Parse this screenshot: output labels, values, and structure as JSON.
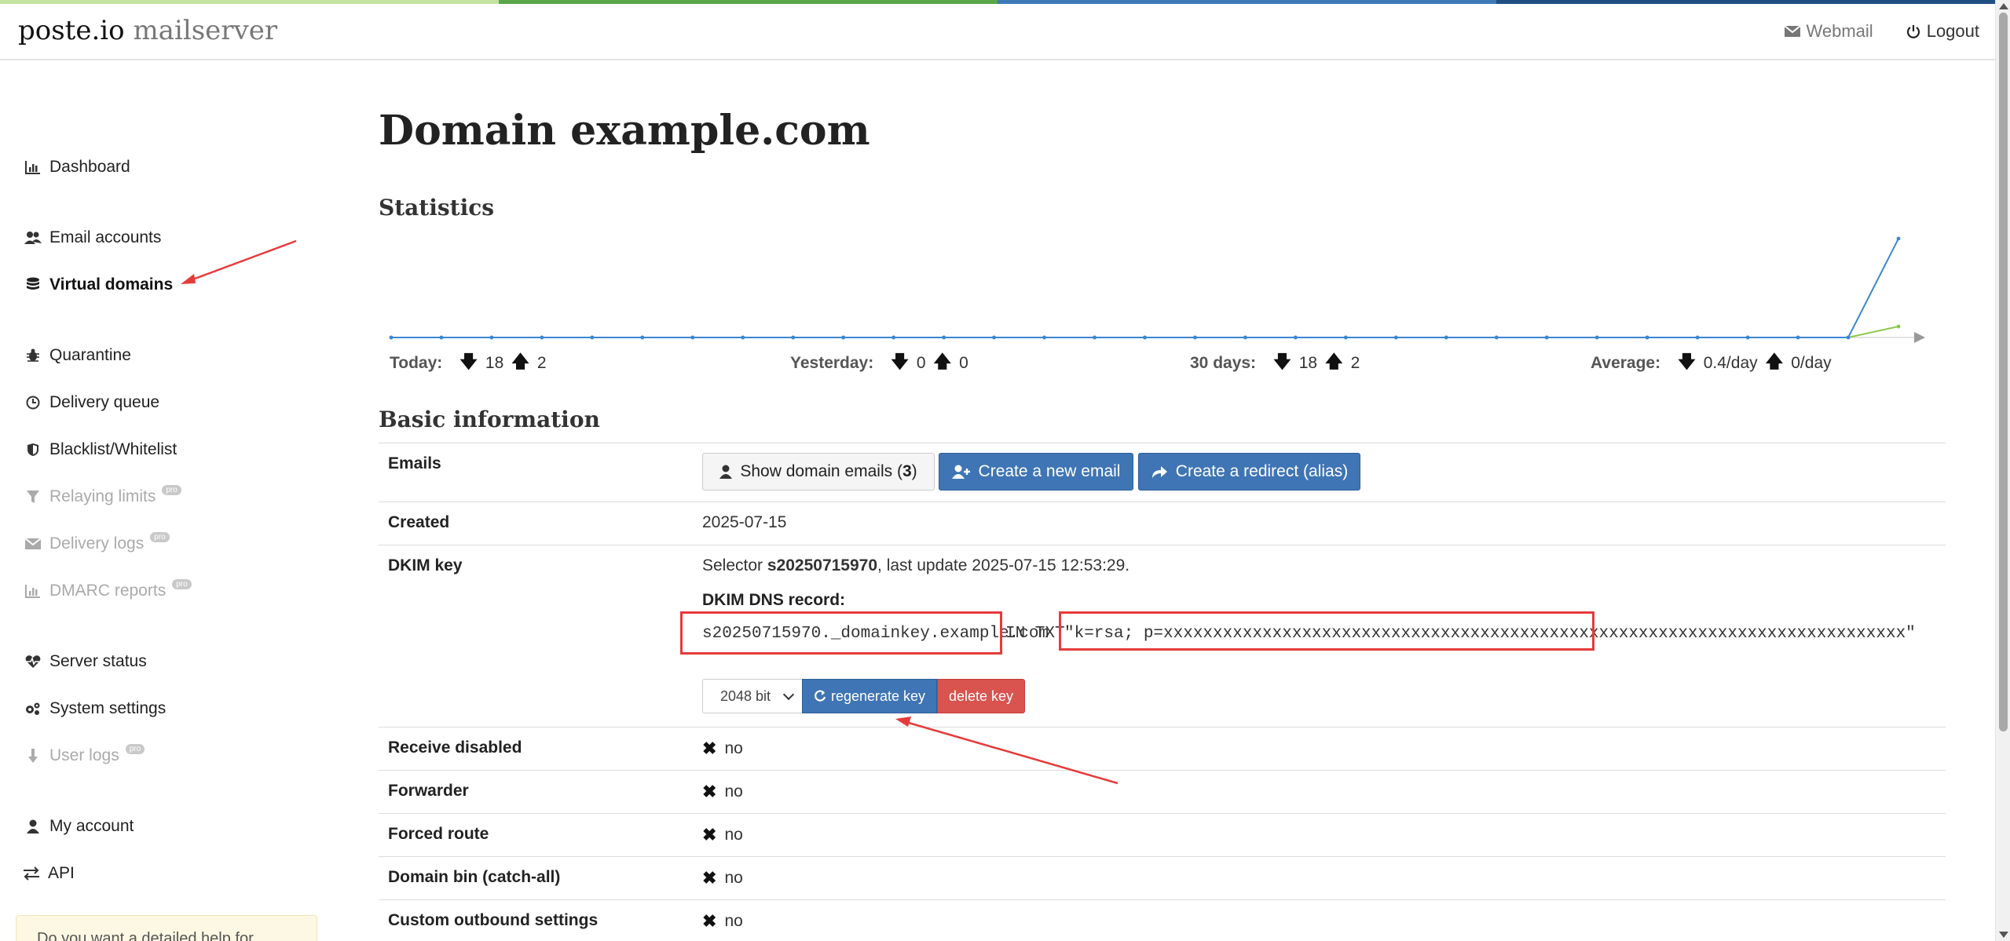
{
  "colors": {
    "topbar": [
      "#c5e3a3",
      "#5aa64a",
      "#3e79b8",
      "#1f4f82"
    ],
    "primary": "#3f75b5",
    "danger": "#d9534f",
    "annotation": "#e53b3b",
    "chart_series_in": "#3a87d4",
    "chart_series_out": "#8cc84b"
  },
  "header": {
    "brand": "poste.io",
    "brand_suffix": "mailserver",
    "webmail": "Webmail",
    "logout": "Logout",
    "webmail_icon": "envelope-icon",
    "logout_icon": "power-icon"
  },
  "sidebar": {
    "items": [
      {
        "label": "Dashboard",
        "icon": "bar-chart-icon"
      },
      {
        "label": "Email accounts",
        "icon": "users-icon"
      },
      {
        "label": "Virtual domains",
        "icon": "database-icon"
      },
      {
        "label": "Quarantine",
        "icon": "bug-icon"
      },
      {
        "label": "Delivery queue",
        "icon": "clock-icon"
      },
      {
        "label": "Blacklist/Whitelist",
        "icon": "shield-icon"
      },
      {
        "label": "Relaying limits",
        "icon": "filter-icon",
        "badge": "pro"
      },
      {
        "label": "Delivery logs",
        "icon": "envelope-icon",
        "badge": "pro"
      },
      {
        "label": "DMARC reports",
        "icon": "bar-chart-icon",
        "badge": "pro"
      },
      {
        "label": "Server status",
        "icon": "heartbeat-icon"
      },
      {
        "label": "System settings",
        "icon": "cogs-icon"
      },
      {
        "label": "User logs",
        "icon": "user-log-icon",
        "badge": "pro"
      },
      {
        "label": "My account",
        "icon": "user-icon"
      },
      {
        "label": "API",
        "icon": "exchange-icon"
      }
    ],
    "help_box": "Do you want a detailed help for"
  },
  "main": {
    "title": "Domain example.com",
    "statistics_title": "Statistics",
    "stats": [
      {
        "label": "Today:",
        "down": "18",
        "up": "2"
      },
      {
        "label": "Yesterday:",
        "down": "0",
        "up": "0"
      },
      {
        "label": "30 days:",
        "down": "18",
        "up": "2"
      },
      {
        "label": "Average:",
        "down": "0.4/day",
        "up": "0/day"
      }
    ],
    "basic_title": "Basic information",
    "rows": {
      "emails": {
        "key": "Emails",
        "show_btn": "Show domain emails (",
        "show_count": "3",
        "show_btn_end": ")",
        "create_email": "Create a new email",
        "create_redirect": "Create a redirect (alias)"
      },
      "created": {
        "key": "Created",
        "value": "2025-07-15"
      },
      "dkim": {
        "key": "DKIM key",
        "selector_prefix": "Selector ",
        "selector": "s20250715970",
        "selector_suffix": ", last update 2025-07-15 12:53:29.",
        "record_label": "DKIM DNS record:",
        "record_name": "s20250715970._domainkey.example.com",
        "record_type": "IN TXT",
        "record_value": "\"k=rsa; p=xxxxxxxxxxxxxxxxxxxxxxxxxxxxxxxxxxxxxxxxxxxxxxxxxxxxxxxxxxxxxxxxxxxxxxxxxxx\"",
        "bits": "2048 bit",
        "regenerate": "regenerate key",
        "delete": "delete key"
      },
      "receive_disabled": {
        "key": "Receive disabled",
        "value": "no"
      },
      "forwarder": {
        "key": "Forwarder",
        "value": "no"
      },
      "forced_route": {
        "key": "Forced route",
        "value": "no"
      },
      "domain_bin": {
        "key": "Domain bin (catch-all)",
        "value": "no"
      },
      "custom_outbound": {
        "key": "Custom outbound settings",
        "value": "no"
      }
    }
  },
  "chart_data": {
    "type": "line",
    "title": "",
    "xlabel": "",
    "ylabel": "",
    "x_count": 31,
    "series": [
      {
        "values": [
          0,
          0,
          0,
          0,
          0,
          0,
          0,
          0,
          0,
          0,
          0,
          0,
          0,
          0,
          0,
          0,
          0,
          0,
          0,
          0,
          0,
          0,
          0,
          0,
          0,
          0,
          0,
          0,
          0,
          0,
          18
        ]
      },
      {
        "values": [
          0,
          0,
          0,
          0,
          0,
          0,
          0,
          0,
          0,
          0,
          0,
          0,
          0,
          0,
          0,
          0,
          0,
          0,
          0,
          0,
          0,
          0,
          0,
          0,
          0,
          0,
          0,
          0,
          0,
          0,
          2
        ]
      }
    ],
    "ylim": [
      0,
      18
    ],
    "grid": false
  }
}
